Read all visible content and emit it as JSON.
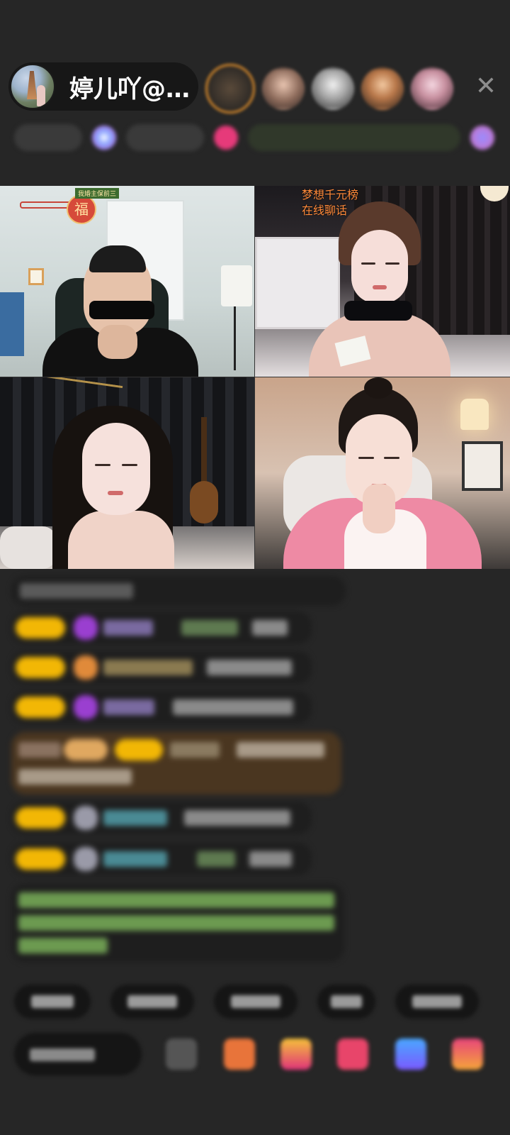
{
  "header": {
    "host_name": "婷儿吖@…",
    "close_symbol": "✕"
  },
  "video_grid": {
    "cell_1_sticker": "我婚主保前三",
    "cell_1_ornament": "福",
    "cell_2_overlay_line1": "梦想千元榜",
    "cell_2_overlay_line2": "在线聊话"
  },
  "icons": {
    "close": "close-icon",
    "host_avatar": "avatar-icon",
    "gift": "gift-icon",
    "emoji": "emoji-icon",
    "share": "share-icon",
    "more": "more-icon"
  },
  "colors": {
    "background": "#262626",
    "level_badge": "#f2b705",
    "highlight_message": "#4a3620",
    "overlay_text": "#ff8a3a",
    "system_text": "#8ac46a"
  }
}
